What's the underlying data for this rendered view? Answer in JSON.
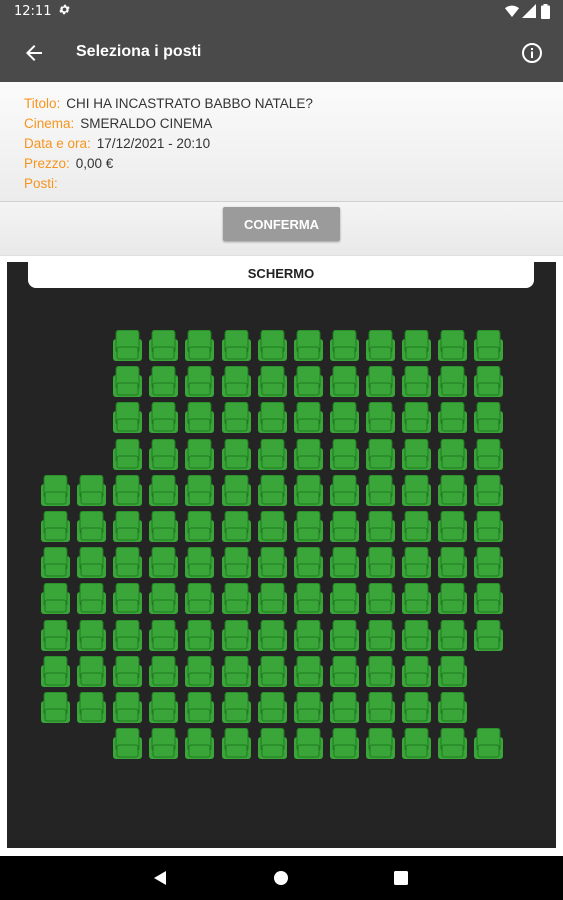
{
  "status_bar": {
    "time": "12:11"
  },
  "app_bar": {
    "title": "Seleziona i posti"
  },
  "info": {
    "title_label": "Titolo:",
    "title_value": "CHI HA INCASTRATO BABBO NATALE?",
    "cinema_label": "Cinema:",
    "cinema_value": "SMERALDO CINEMA",
    "date_label": "Data e ora:",
    "date_value": "17/12/2021 - 20:10",
    "price_label": "Prezzo:",
    "price_value": "0,00 €",
    "seats_label": "Posti:",
    "seats_value": ""
  },
  "confirm_label": "CONFERMA",
  "screen_label": "SCHERMO",
  "colors": {
    "accent_label": "#f7941d",
    "seat_available": "#3aa63a",
    "hall_background": "#242424",
    "bar_background": "#4a4a4a",
    "confirm_button": "#9b9b9b"
  },
  "seat_map": {
    "rows": [
      [
        2,
        11
      ],
      [
        2,
        11
      ],
      [
        2,
        11
      ],
      [
        2,
        11
      ],
      [
        0,
        13
      ],
      [
        0,
        13
      ],
      [
        0,
        13
      ],
      [
        0,
        13
      ],
      [
        0,
        13
      ],
      [
        0,
        12
      ],
      [
        0,
        12
      ],
      [
        2,
        11
      ]
    ]
  },
  "icons": {
    "status": [
      "gear-icon",
      "wifi-icon",
      "signal-icon",
      "battery-icon"
    ],
    "app_bar": [
      "back-arrow-icon",
      "info-icon"
    ],
    "navigation": [
      "nav-back-icon",
      "nav-home-icon",
      "nav-recent-icon"
    ]
  }
}
